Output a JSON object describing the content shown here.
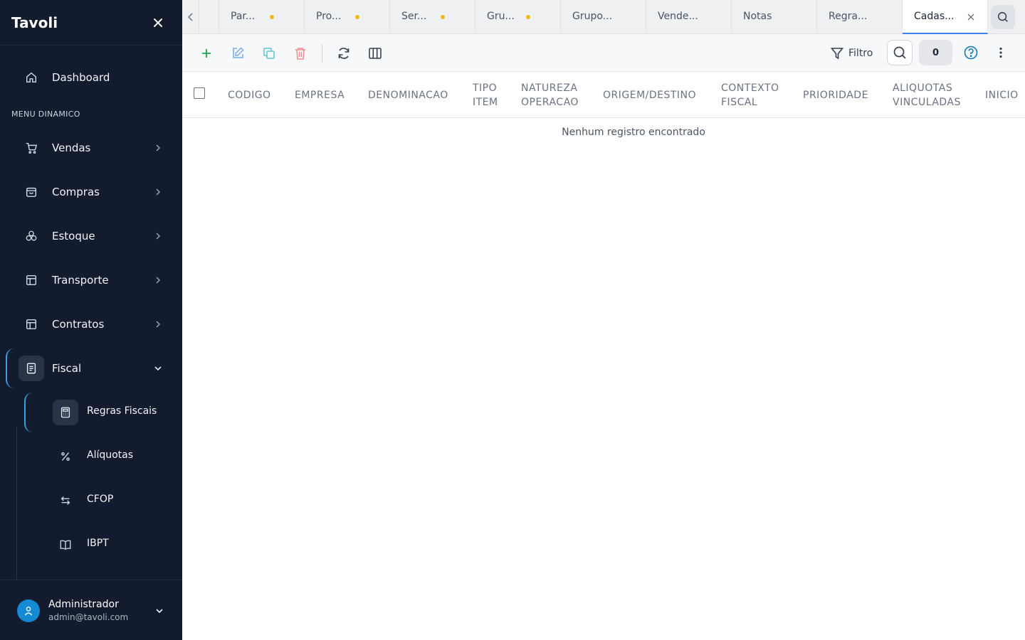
{
  "brand": {
    "name": "Tavoli"
  },
  "sidebar": {
    "dashboard": "Dashboard",
    "section_title": "MENU DINAMICO",
    "items": [
      {
        "label": "Vendas",
        "icon": "cart-icon"
      },
      {
        "label": "Compras",
        "icon": "bag-icon"
      },
      {
        "label": "Estoque",
        "icon": "boxes-icon"
      },
      {
        "label": "Transporte",
        "icon": "layout-icon"
      },
      {
        "label": "Contratos",
        "icon": "layout-icon"
      },
      {
        "label": "Fiscal",
        "icon": "document-icon"
      }
    ],
    "fiscal_sub": [
      {
        "label": "Regras Fiscais",
        "icon": "calculator-icon"
      },
      {
        "label": "Alíquotas",
        "icon": "percent-icon"
      },
      {
        "label": "CFOP",
        "icon": "arrows-exchange-icon"
      },
      {
        "label": "IBPT",
        "icon": "book-icon"
      }
    ]
  },
  "user": {
    "name": "Administrador",
    "email": "admin@tavoli.com"
  },
  "tabs": [
    {
      "label": "Par...",
      "dot": true
    },
    {
      "label": "Pro...",
      "dot": true
    },
    {
      "label": "Ser...",
      "dot": true
    },
    {
      "label": "Gru...",
      "dot": true
    },
    {
      "label": "Grupo...",
      "dot": false
    },
    {
      "label": "Vende...",
      "dot": false
    },
    {
      "label": "Notas",
      "dot": false
    },
    {
      "label": "Regra...",
      "dot": false
    },
    {
      "label": "Cadas...",
      "dot": false,
      "active": true
    }
  ],
  "toolbar": {
    "filter_label": "Filtro",
    "count": "0"
  },
  "table": {
    "columns": [
      [
        "CODIGO"
      ],
      [
        "EMPRESA"
      ],
      [
        "DENOMINACAO"
      ],
      [
        "TIPO",
        "ITEM"
      ],
      [
        "NATUREZA",
        "OPERACAO"
      ],
      [
        "ORIGEM/DESTINO"
      ],
      [
        "CONTEXTO",
        "FISCAL"
      ],
      [
        "PRIORIDADE"
      ],
      [
        "ALIQUOTAS",
        "VINCULADAS"
      ],
      [
        "INICIO"
      ]
    ],
    "empty_message": "Nenhum registro encontrado"
  },
  "colors": {
    "sidebar_bg": "#131c2e",
    "accent": "#3aa0e6",
    "tab_dot": "#f5b81c",
    "add": "#16a34a",
    "delete": "#ef4444"
  }
}
